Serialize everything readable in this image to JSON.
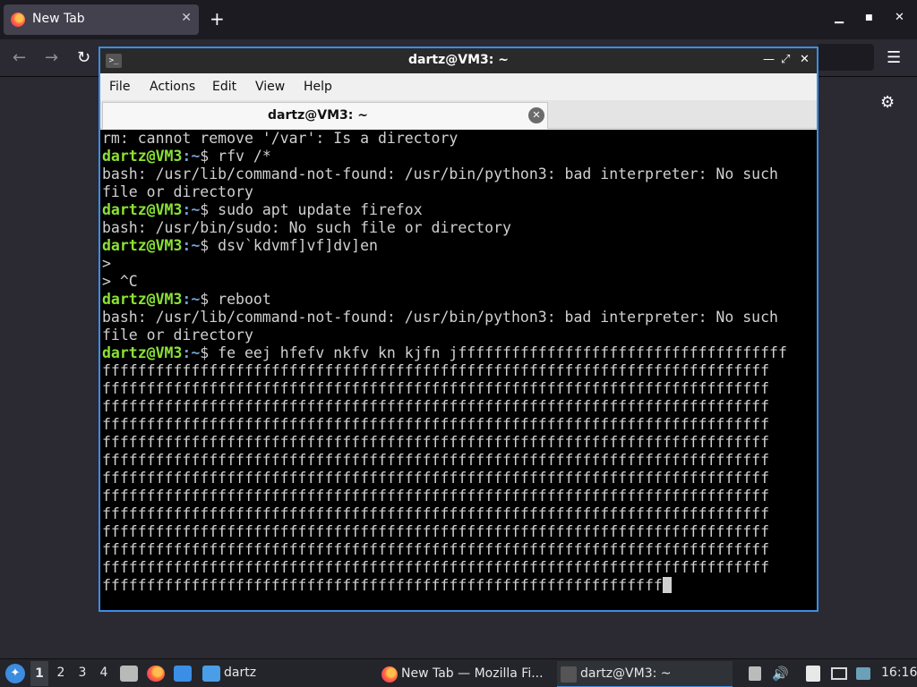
{
  "browser": {
    "tab_title": "New Tab",
    "tab_close": "✕",
    "new_tab": "+",
    "minimize": "▁",
    "maximize": "■",
    "close": "✕",
    "back": "←",
    "forward": "→",
    "reload": "↻",
    "menu": "☰",
    "settings": "⚙"
  },
  "terminal": {
    "window_title": "dartz@VM3: ~",
    "icon_glyph": ">_",
    "ctl_minimize": "—",
    "ctl_restore": "⤢",
    "ctl_close": "✕",
    "menu": [
      "File",
      "Actions",
      "Edit",
      "View",
      "Help"
    ],
    "tab_title": "dartz@VM3: ~",
    "tab_close": "✕",
    "prompt_user": "dartz@VM3",
    "prompt_path": ":~",
    "prompt_sym": "$ ",
    "lines": [
      {
        "type": "out",
        "text": "rm: cannot remove '/var': Is a directory"
      },
      {
        "type": "cmd",
        "text": "rfv /*"
      },
      {
        "type": "out",
        "text": "bash: /usr/lib/command-not-found: /usr/bin/python3: bad interpreter: No such"
      },
      {
        "type": "out",
        "text": "file or directory"
      },
      {
        "type": "cmd",
        "text": "sudo apt update firefox"
      },
      {
        "type": "out",
        "text": "bash: /usr/bin/sudo: No such file or directory"
      },
      {
        "type": "cmd",
        "text": "dsv`kdvmf]vf]dv]en"
      },
      {
        "type": "out",
        "text": ">"
      },
      {
        "type": "out",
        "text": "> ^C"
      },
      {
        "type": "cmd",
        "text": "reboot"
      },
      {
        "type": "out",
        "text": "bash: /usr/lib/command-not-found: /usr/bin/python3: bad interpreter: No such"
      },
      {
        "type": "out",
        "text": "file or directory"
      },
      {
        "type": "cmd",
        "text": "fe eej hfefv nkfv kn kjfn jfffffffffffffffffffffffffffffffffffff"
      },
      {
        "type": "out",
        "text": "fffffffffffffffffffffffffffffffffffffffffffffffffffffffffffffffffffffffffff"
      },
      {
        "type": "out",
        "text": "fffffffffffffffffffffffffffffffffffffffffffffffffffffffffffffffffffffffffff"
      },
      {
        "type": "out",
        "text": "fffffffffffffffffffffffffffffffffffffffffffffffffffffffffffffffffffffffffff"
      },
      {
        "type": "out",
        "text": "fffffffffffffffffffffffffffffffffffffffffffffffffffffffffffffffffffffffffff"
      },
      {
        "type": "out",
        "text": "fffffffffffffffffffffffffffffffffffffffffffffffffffffffffffffffffffffffffff"
      },
      {
        "type": "out",
        "text": "fffffffffffffffffffffffffffffffffffffffffffffffffffffffffffffffffffffffffff"
      },
      {
        "type": "out",
        "text": "fffffffffffffffffffffffffffffffffffffffffffffffffffffffffffffffffffffffffff"
      },
      {
        "type": "out",
        "text": "fffffffffffffffffffffffffffffffffffffffffffffffffffffffffffffffffffffffffff"
      },
      {
        "type": "out",
        "text": "fffffffffffffffffffffffffffffffffffffffffffffffffffffffffffffffffffffffffff"
      },
      {
        "type": "out",
        "text": "fffffffffffffffffffffffffffffffffffffffffffffffffffffffffffffffffffffffffff"
      },
      {
        "type": "out",
        "text": "fffffffffffffffffffffffffffffffffffffffffffffffffffffffffffffffffffffffffff"
      },
      {
        "type": "out",
        "text": "fffffffffffffffffffffffffffffffffffffffffffffffffffffffffffffffffffffffffff"
      },
      {
        "type": "out",
        "text": "fffffffffffffffffffffffffffffffffffffffffffffffffffffffffffffff",
        "cursor": true
      }
    ]
  },
  "taskbar": {
    "start_glyph": "✦",
    "workspaces": [
      "1",
      "2",
      "3",
      "4"
    ],
    "active_workspace": "1",
    "folder_label": "dartz",
    "tasks": [
      {
        "label": "New Tab — Mozilla Fi...",
        "icon": "firefox-icon"
      },
      {
        "label": "dartz@VM3: ~",
        "icon": "terminal-icon",
        "active": true
      }
    ],
    "tray_volume": "🔊",
    "clock": "16:16"
  },
  "colors": {
    "accent": "#3a8ee6",
    "prompt_user": "#8ae234",
    "prompt_path": "#729fcf",
    "terminal_bg": "#000000"
  }
}
